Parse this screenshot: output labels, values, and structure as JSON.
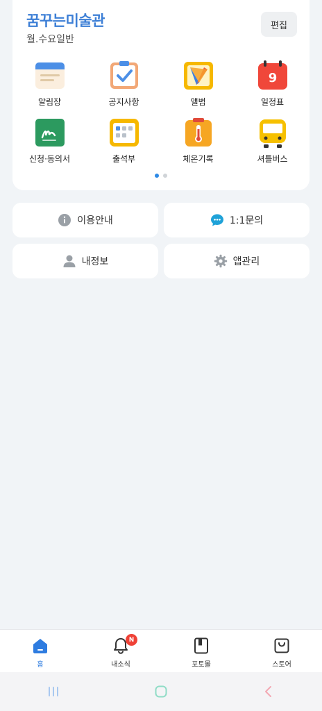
{
  "header": {
    "title": "꿈꾸는미술관",
    "subtitle": "월.수요일반",
    "edit_label": "편집"
  },
  "menu": [
    {
      "label": "알림장",
      "icon": "notice-board-icon"
    },
    {
      "label": "공지사항",
      "icon": "checklist-icon"
    },
    {
      "label": "앨범",
      "icon": "album-icon"
    },
    {
      "label": "일정표",
      "icon": "calendar-icon",
      "day": "9"
    },
    {
      "label": "신청·동의서",
      "icon": "signature-icon"
    },
    {
      "label": "출석부",
      "icon": "attendance-icon"
    },
    {
      "label": "체온기록",
      "icon": "thermometer-icon"
    },
    {
      "label": "셔틀버스",
      "icon": "bus-icon"
    }
  ],
  "pager": {
    "pages": 2,
    "current": 1
  },
  "quick": {
    "info": "이용안내",
    "inquiry": "1:1문의",
    "myinfo": "내정보",
    "appmanage": "앱관리"
  },
  "tabs": {
    "home": "홈",
    "news": "내소식",
    "news_badge": "N",
    "portfolio": "포토몰",
    "store": "스토어"
  },
  "colors": {
    "accent": "#3d7fd6",
    "active_tab": "#2e7ce0",
    "badge": "#ef4136",
    "background": "#f1f4f7"
  }
}
